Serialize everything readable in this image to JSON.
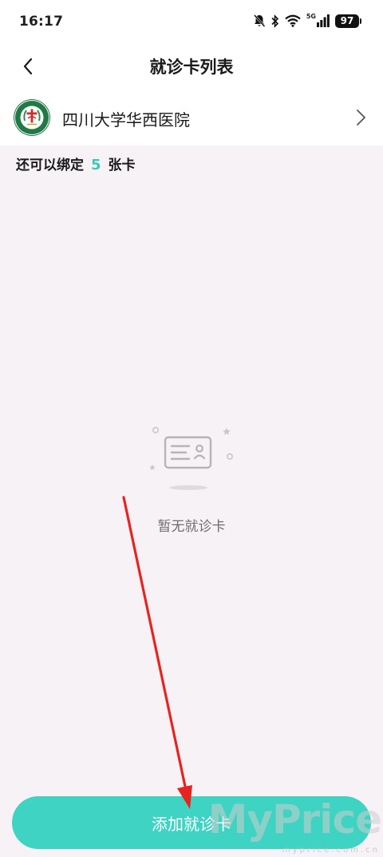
{
  "status_bar": {
    "time": "16:17",
    "network_label": "5G",
    "battery": "97",
    "icons": [
      "bell-off-icon",
      "bluetooth-icon",
      "wifi-icon",
      "signal-icon",
      "battery-icon"
    ]
  },
  "nav": {
    "title": "就诊卡列表",
    "back_icon": "chevron-left-icon"
  },
  "hospital": {
    "name": "四川大学华西医院",
    "logo_icon": "hospital-logo",
    "chevron_icon": "chevron-right-icon"
  },
  "bind_info": {
    "prefix": "还可以绑定",
    "count": "5",
    "suffix": "张卡"
  },
  "empty_state": {
    "icon": "card-empty-icon",
    "text": "暂无就诊卡"
  },
  "add_button": {
    "label": "添加就诊卡"
  },
  "watermark": {
    "main": "MyPrice",
    "sub": "myprice.com.cn"
  },
  "colors": {
    "accent": "#3ed3c2",
    "count_color": "#3ac9b4",
    "content_bg": "#f6f2f6",
    "arrow": "#e8231f"
  }
}
